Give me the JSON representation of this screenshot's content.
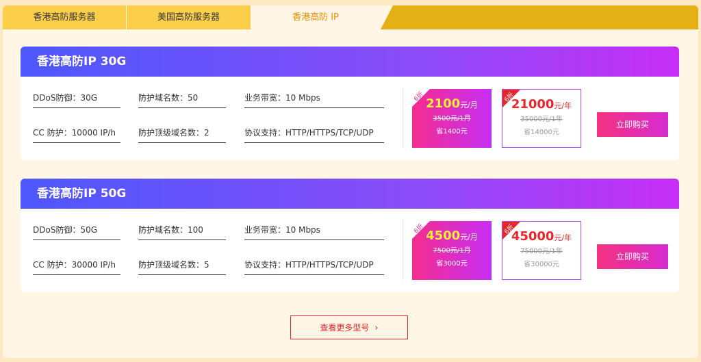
{
  "tabs": [
    {
      "label": "香港高防服务器",
      "active": false
    },
    {
      "label": "美国高防服务器",
      "active": false
    },
    {
      "label": "香港高防 IP",
      "active": true
    }
  ],
  "products": [
    {
      "title": "香港高防IP 30G",
      "specs": {
        "ddos": "DDoS防御：30G",
        "domains": "防护域名数：50",
        "bandwidth": "业务带宽：10 Mbps",
        "cc": "CC 防护：10000 IP/h",
        "top_domains": "防护顶级域名数：2",
        "protocols": "协议支持：HTTP/HTTPS/TCP/UDP"
      },
      "monthly": {
        "badge": "6折",
        "price": "2100",
        "unit": "元/月",
        "original": "3500元/1月",
        "save": "省1400元"
      },
      "yearly": {
        "badge": "6折",
        "price": "21000",
        "unit": "元/年",
        "original": "35000元/1年",
        "save": "省14000元"
      },
      "buy_label": "立即购买"
    },
    {
      "title": "香港高防IP 50G",
      "specs": {
        "ddos": "DDoS防御：50G",
        "domains": "防护域名数：100",
        "bandwidth": "业务带宽：10 Mbps",
        "cc": "CC 防护：30000 IP/h",
        "top_domains": "防护顶级域名数：5",
        "protocols": "协议支持：HTTP/HTTPS/TCP/UDP"
      },
      "monthly": {
        "badge": "6折",
        "price": "4500",
        "unit": "元/月",
        "original": "7500元/1月",
        "save": "省3000元"
      },
      "yearly": {
        "badge": "6折",
        "price": "45000",
        "unit": "元/年",
        "original": "75000元/1年",
        "save": "省30000元"
      },
      "buy_label": "立即购买"
    }
  ],
  "more_button": {
    "label": "查看更多型号",
    "icon": "chevron-right-icon"
  },
  "colors": {
    "accent": "#f08c00",
    "tab_inactive": "#fccf4a",
    "tab_bar": "#e3b016",
    "header_gradient_start": "#4d58fd",
    "header_gradient_end": "#c72ef5",
    "price_red": "#e5262b",
    "price_yellow": "#ffeb3b"
  }
}
